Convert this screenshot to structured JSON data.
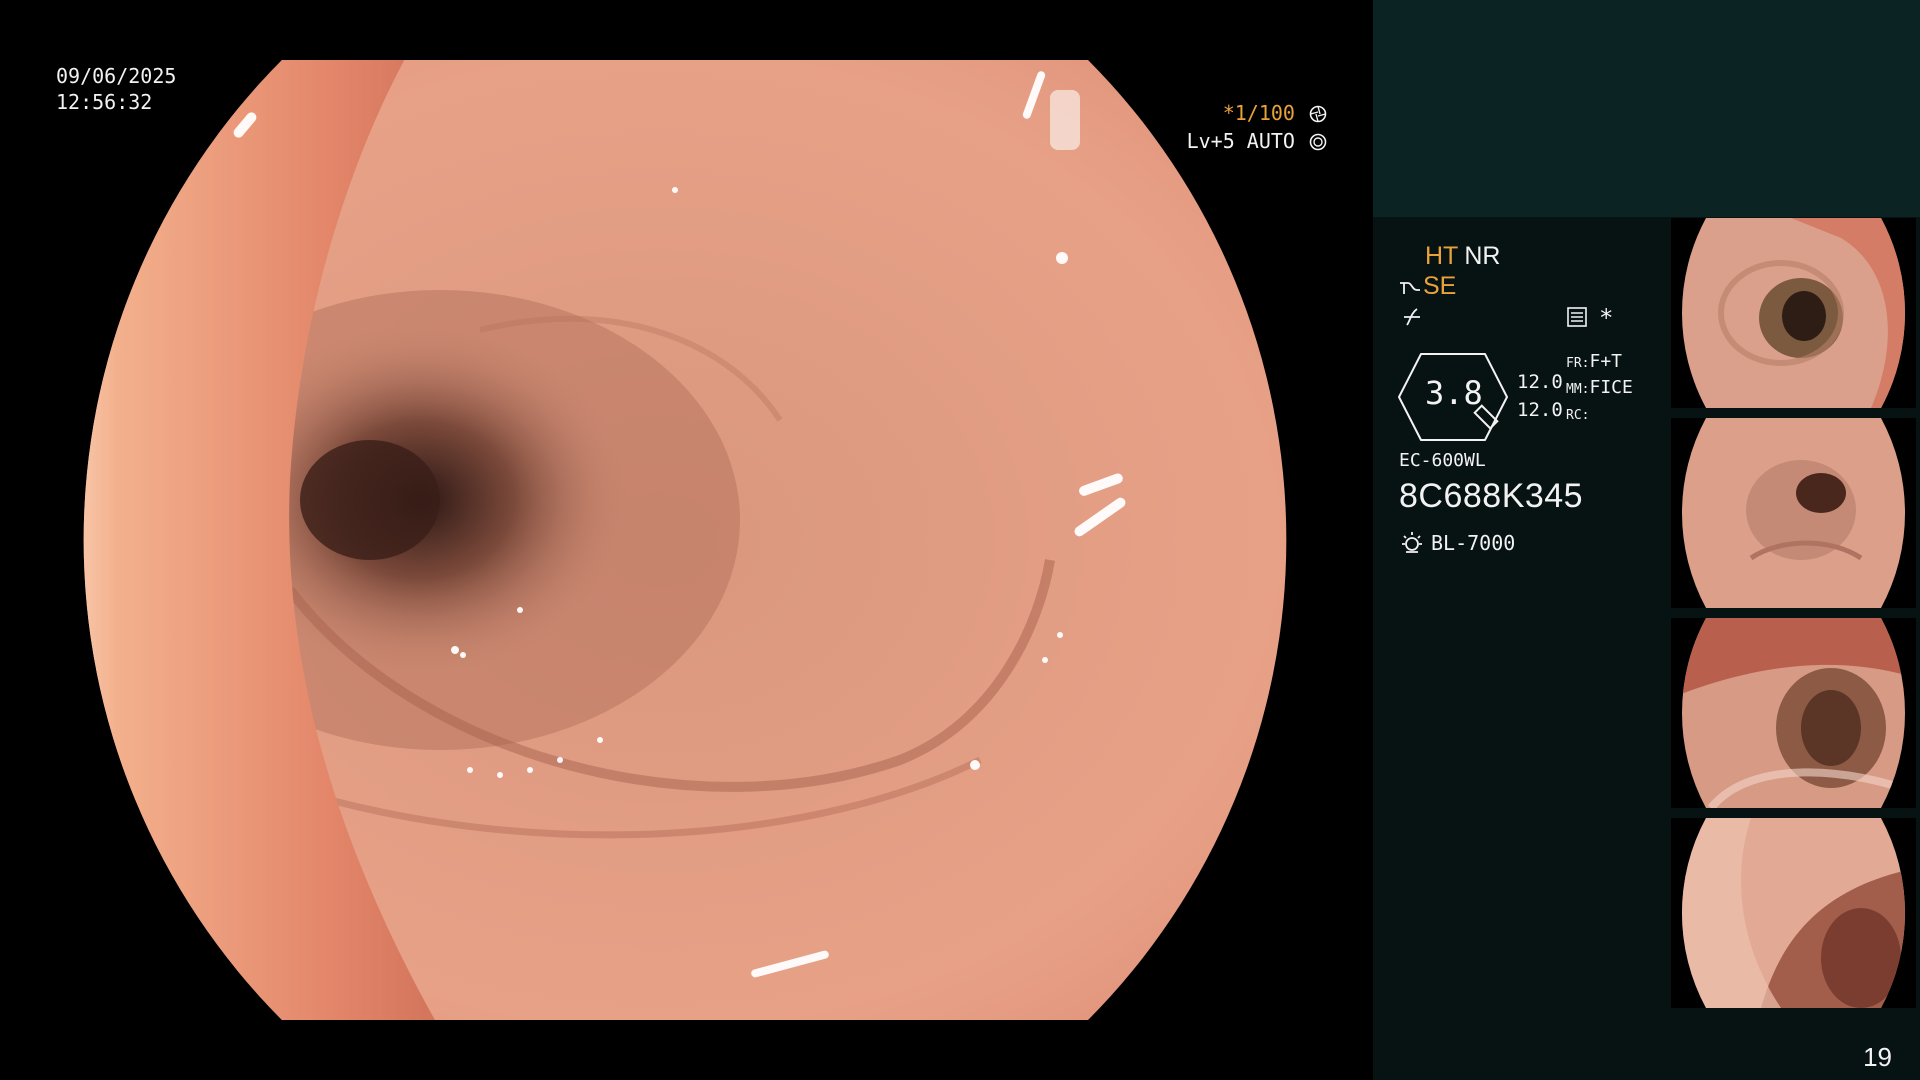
{
  "overlay": {
    "date": "09/06/2025",
    "time": "12:56:32",
    "shutter": "*1/100",
    "level": "Lv+5 AUTO"
  },
  "panel": {
    "ht": "HT",
    "nr": "NR",
    "se": "SE",
    "star": "*",
    "zoom": "3.8",
    "val1": "12.0",
    "val2": "12.0",
    "fr": "FR:",
    "fr_val": "F+T",
    "mm": "MM:",
    "mm_val": "FICE",
    "rc": "RC:",
    "scope_model": "EC-600WL",
    "scope_serial": "8C688K345",
    "light_source": "BL-7000",
    "page_number": "19"
  },
  "colors": {
    "accent_orange": "#e9a23b",
    "panel_dark": "#071213",
    "panel_teal": "#0b2323"
  },
  "icons": [
    "shutter-icon",
    "auto-iris-icon",
    "structure-enhance-icon",
    "enhancement-icon",
    "memo-icon",
    "light-source-icon"
  ]
}
